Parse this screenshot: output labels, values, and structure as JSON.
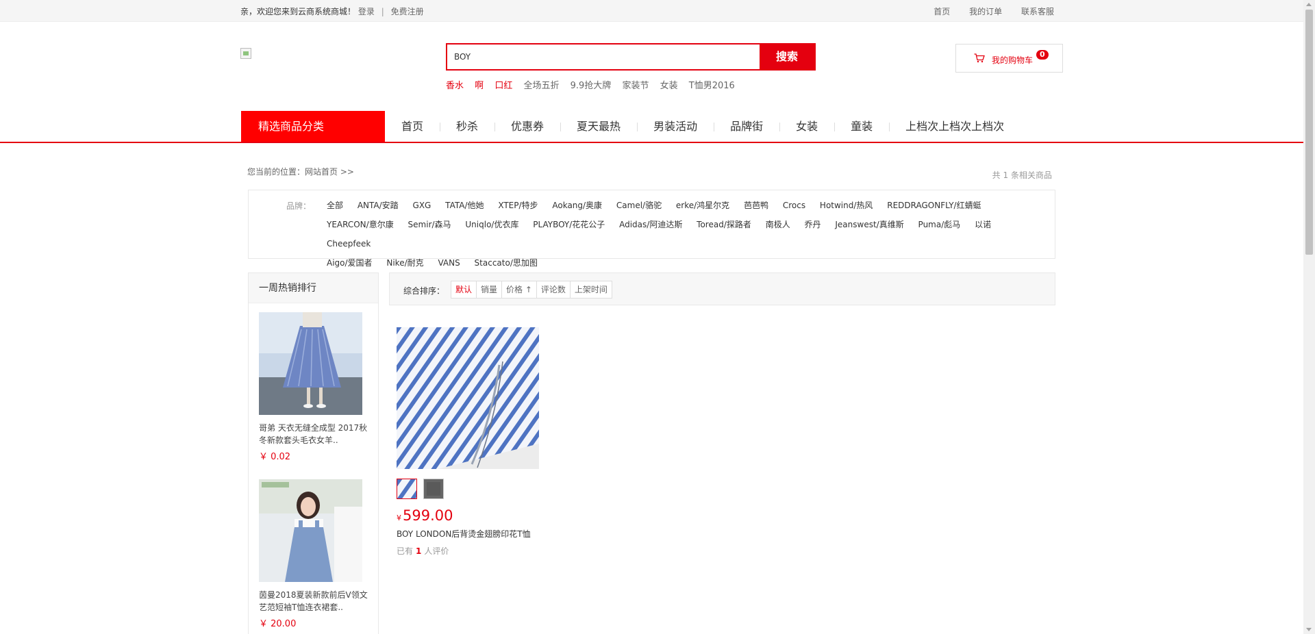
{
  "topbar": {
    "welcome": "亲，欢迎您来到云商系统商城！",
    "login": "登录",
    "separator": "|",
    "register": "免费注册",
    "links": [
      "首页",
      "我的订单",
      "联系客服"
    ]
  },
  "search": {
    "value": "BOY",
    "button": "搜索",
    "hotwords": [
      {
        "text": "香水",
        "highlight": true
      },
      {
        "text": "啊",
        "highlight": true
      },
      {
        "text": "口红",
        "highlight": true
      },
      {
        "text": "全场五折",
        "highlight": false
      },
      {
        "text": "9.9抢大牌",
        "highlight": false
      },
      {
        "text": "家装节",
        "highlight": false
      },
      {
        "text": "女装",
        "highlight": false
      },
      {
        "text": "T恤男2016",
        "highlight": false
      }
    ]
  },
  "cart": {
    "label": "我的购物车",
    "count": "0"
  },
  "nav": {
    "category": "精选商品分类",
    "items": [
      "首页",
      "秒杀",
      "优惠券",
      "夏天最热",
      "男装活动",
      "品牌街",
      "女装",
      "童装",
      "上档次上档次上档次"
    ]
  },
  "location": {
    "prefix": "您当前的位置：",
    "home": "网站首页",
    "arrow": ">>"
  },
  "result_count": {
    "prefix": "共",
    "number": "1",
    "suffix": "条相关商品"
  },
  "brands": {
    "label": "品牌：",
    "items": [
      "全部",
      "ANTA/安踏",
      "GXG",
      "TATA/他她",
      "XTEP/特步",
      "Aokang/奥康",
      "Camel/骆驼",
      "erke/鸿星尔克",
      "芭芭鸭",
      "Crocs",
      "Hotwind/热风",
      "REDDRAGONFLY/红蜻蜓",
      "YEARCON/意尔康",
      "Semir/森马",
      "Uniqlo/优衣库",
      "PLAYBOY/花花公子",
      "Adidas/阿迪达斯",
      "Toread/探路者",
      "南极人",
      "乔丹",
      "Jeanswest/真维斯",
      "Puma/彪马",
      "以诺",
      "Cheepfeek",
      "Aigo/爱国者",
      "Nike/耐克",
      "VANS",
      "Staccato/思加图"
    ]
  },
  "sidebar": {
    "title": "一周热销排行",
    "items": [
      {
        "name": "哥弟 天衣无缝全成型 2017秋冬新款套头毛衣女羊..",
        "price": "￥ 0.02"
      },
      {
        "name": "茵曼2018夏装新款前后V领文艺范短袖T恤连衣裙套..",
        "price": "￥ 20.00"
      }
    ]
  },
  "sort": {
    "label": "综合排序：",
    "options": [
      {
        "text": "默认",
        "active": true
      },
      {
        "text": "销量",
        "active": false
      },
      {
        "text": "价格 ↑",
        "active": false
      },
      {
        "text": "评论数",
        "active": false
      },
      {
        "text": "上架时间",
        "active": false
      }
    ]
  },
  "product": {
    "currency": "¥",
    "price": "599.00",
    "name": "BOY LONDON后背烫金翅膀印花T恤",
    "comments_prefix": "已有",
    "comments_count": "1",
    "comments_suffix": "人评价"
  },
  "colors": {
    "accent": "#e4000f",
    "nav_category_bg": "#ff0000"
  }
}
